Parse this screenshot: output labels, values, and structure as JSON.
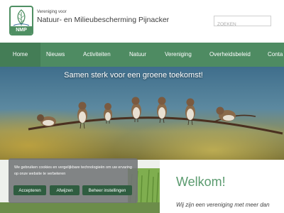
{
  "header": {
    "logo_letters": "NMP",
    "org_line1": "Vereniging voor",
    "org_line2": "Natuur- en Milieubescherming Pijnacker"
  },
  "search": {
    "placeholder": "ZOEKEN"
  },
  "nav": {
    "items": [
      {
        "label": "Home"
      },
      {
        "label": "Nieuws"
      },
      {
        "label": "Activiteiten"
      },
      {
        "label": "Natuur"
      },
      {
        "label": "Vereniging"
      },
      {
        "label": "Overheidsbeleid"
      },
      {
        "label": "Conta"
      }
    ]
  },
  "hero": {
    "title": "Samen sterk voor een groene toekomst!"
  },
  "content": {
    "welcome": "Welkom!",
    "intro": "Wij zijn een vereniging met meer dan"
  },
  "cookie": {
    "text": "We gebruiken cookies en vergelijkbare technologieën om uw ervaring op onze website te verbeteren",
    "accept_label": "Accepteren",
    "decline_label": "Afwijzen",
    "manage_label": "Beheer instellingen"
  },
  "colors": {
    "nav_green": "#4e8b62",
    "nav_active": "#447d56",
    "welcome_green": "#5a9a6e",
    "button_green": "#2f5d40"
  }
}
